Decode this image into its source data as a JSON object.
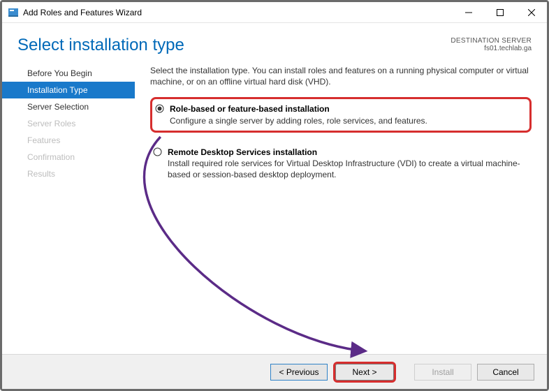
{
  "titlebar": {
    "text": "Add Roles and Features Wizard"
  },
  "header": {
    "title": "Select installation type",
    "destination_label": "DESTINATION SERVER",
    "destination_value": "fs01.techlab.ga"
  },
  "sidebar": {
    "steps": [
      {
        "label": "Before You Begin",
        "state": "normal"
      },
      {
        "label": "Installation Type",
        "state": "active"
      },
      {
        "label": "Server Selection",
        "state": "normal"
      },
      {
        "label": "Server Roles",
        "state": "disabled"
      },
      {
        "label": "Features",
        "state": "disabled"
      },
      {
        "label": "Confirmation",
        "state": "disabled"
      },
      {
        "label": "Results",
        "state": "disabled"
      }
    ]
  },
  "main": {
    "intro": "Select the installation type. You can install roles and features on a running physical computer or virtual machine, or on an offline virtual hard disk (VHD).",
    "options": [
      {
        "title": "Role-based or feature-based installation",
        "desc": "Configure a single server by adding roles, role services, and features.",
        "selected": true,
        "highlight": true
      },
      {
        "title": "Remote Desktop Services installation",
        "desc": "Install required role services for Virtual Desktop Infrastructure (VDI) to create a virtual machine-based or session-based desktop deployment.",
        "selected": false,
        "highlight": false
      }
    ]
  },
  "footer": {
    "previous": "< Previous",
    "next": "Next >",
    "install": "Install",
    "cancel": "Cancel"
  }
}
